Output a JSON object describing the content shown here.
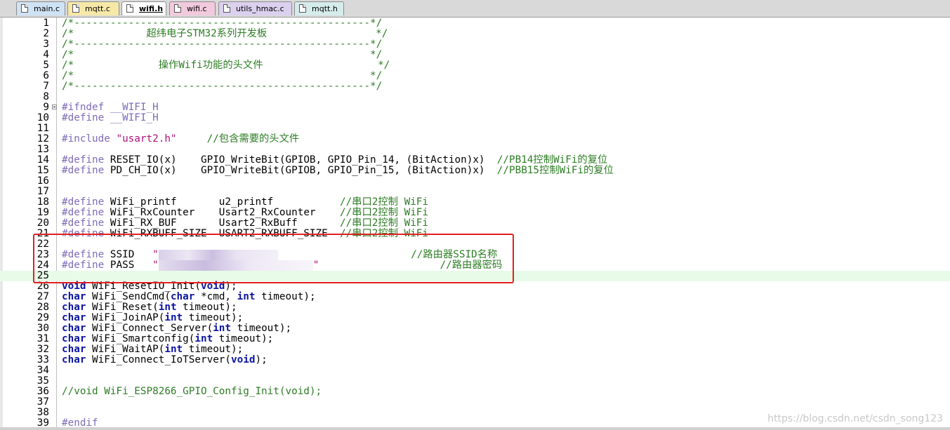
{
  "tabs": [
    {
      "label": "main.c",
      "color": "#cfe3f5",
      "active": false
    },
    {
      "label": "mqtt.c",
      "color": "#f6e9a8",
      "active": false
    },
    {
      "label": "wifi.h",
      "color": "#dff0c8",
      "active": true
    },
    {
      "label": "wifi.c",
      "color": "#f3c9dd",
      "active": false
    },
    {
      "label": "utils_hmac.c",
      "color": "#dcd0ef",
      "active": false
    },
    {
      "label": "mqtt.h",
      "color": "#d6ecec",
      "active": false
    }
  ],
  "editor": {
    "current_line": 25,
    "lines": [
      {
        "n": "1",
        "segs": [
          [
            "c",
            "/*-------------------------------------------------*/"
          ]
        ]
      },
      {
        "n": "2",
        "segs": [
          [
            "c",
            "/*            超纬电子STM32系列开发板                  */"
          ]
        ]
      },
      {
        "n": "3",
        "segs": [
          [
            "c",
            "/*-------------------------------------------------*/"
          ]
        ]
      },
      {
        "n": "4",
        "segs": [
          [
            "c",
            "/*                                                 */"
          ]
        ]
      },
      {
        "n": "5",
        "segs": [
          [
            "c",
            "/*              操作Wifi功能的头文件                   */"
          ]
        ]
      },
      {
        "n": "6",
        "segs": [
          [
            "c",
            "/*                                                 */"
          ]
        ]
      },
      {
        "n": "7",
        "segs": [
          [
            "c",
            "/*-------------------------------------------------*/"
          ]
        ]
      },
      {
        "n": "8",
        "segs": []
      },
      {
        "n": "9",
        "fold": true,
        "segs": [
          [
            "pp",
            "#ifndef __WIFI_H"
          ]
        ]
      },
      {
        "n": "10",
        "segs": [
          [
            "pp",
            "#define __WIFI_H"
          ]
        ]
      },
      {
        "n": "11",
        "segs": []
      },
      {
        "n": "12",
        "segs": [
          [
            "pp",
            "#include "
          ],
          [
            "st",
            "\"usart2.h\""
          ],
          [
            "pl",
            "     "
          ],
          [
            "c",
            "//包含需要的头文件"
          ]
        ]
      },
      {
        "n": "13",
        "segs": []
      },
      {
        "n": "14",
        "segs": [
          [
            "pp",
            "#define "
          ],
          [
            "pl",
            "RESET_IO(x)    GPIO_WriteBit(GPIOB, GPIO_Pin_14, (BitAction)x)  "
          ],
          [
            "c",
            "//PB14控制WiFi的复位"
          ]
        ]
      },
      {
        "n": "15",
        "segs": [
          [
            "pp",
            "#define "
          ],
          [
            "pl",
            "PD_CH_IO(x)    GPIO_WriteBit(GPIOB, GPIO_Pin_15, (BitAction)x)  "
          ],
          [
            "c",
            "//PBB15控制WiFi的复位"
          ]
        ]
      },
      {
        "n": "16",
        "segs": []
      },
      {
        "n": "17",
        "segs": []
      },
      {
        "n": "18",
        "segs": [
          [
            "pp",
            "#define "
          ],
          [
            "pl",
            "WiFi_printf       u2_printf           "
          ],
          [
            "c",
            "//串口2控制 WiFi"
          ]
        ]
      },
      {
        "n": "19",
        "segs": [
          [
            "pp",
            "#define "
          ],
          [
            "pl",
            "WiFi_RxCounter    Usart2_RxCounter    "
          ],
          [
            "c",
            "//串口2控制 WiFi"
          ]
        ]
      },
      {
        "n": "20",
        "segs": [
          [
            "pp",
            "#define "
          ],
          [
            "pl",
            "WiFi_RX_BUF       Usart2_RxBuff       "
          ],
          [
            "c",
            "//串口2控制 WiFi"
          ]
        ]
      },
      {
        "n": "21",
        "segs": [
          [
            "pp",
            "#define "
          ],
          [
            "pl",
            "WiFi_RXBUFF_SIZE  USART2_RXBUFF_SIZE  "
          ],
          [
            "c",
            "//串口2控制 WiFi"
          ]
        ]
      },
      {
        "n": "22",
        "segs": []
      },
      {
        "n": "23",
        "segs": [
          [
            "pp",
            "#define "
          ],
          [
            "pl",
            "SSID   "
          ],
          [
            "st",
            "\""
          ],
          [
            "blur",
            ""
          ],
          [
            "pl",
            "                      "
          ],
          [
            "c",
            "//路由器SSID名称"
          ]
        ]
      },
      {
        "n": "24",
        "segs": [
          [
            "pp",
            "#define "
          ],
          [
            "pl",
            "PASS   "
          ],
          [
            "st",
            "\""
          ],
          [
            "blur2",
            ""
          ],
          [
            "st",
            "\""
          ],
          [
            "pl",
            "                    "
          ],
          [
            "c",
            "//路由器密码"
          ]
        ]
      },
      {
        "n": "25",
        "segs": []
      },
      {
        "n": "26",
        "segs": [
          [
            "kw",
            "void"
          ],
          [
            "pl",
            " WiFi_ResetIO_Init("
          ],
          [
            "kw",
            "void"
          ],
          [
            "pl",
            ");"
          ]
        ]
      },
      {
        "n": "27",
        "segs": [
          [
            "kw",
            "char"
          ],
          [
            "pl",
            " WiFi_SendCmd("
          ],
          [
            "kw",
            "char"
          ],
          [
            "pl",
            " *cmd, "
          ],
          [
            "kw",
            "int"
          ],
          [
            "pl",
            " timeout);"
          ]
        ]
      },
      {
        "n": "28",
        "segs": [
          [
            "kw",
            "char"
          ],
          [
            "pl",
            " WiFi_Reset("
          ],
          [
            "kw",
            "int"
          ],
          [
            "pl",
            " timeout);"
          ]
        ]
      },
      {
        "n": "29",
        "segs": [
          [
            "kw",
            "char"
          ],
          [
            "pl",
            " WiFi_JoinAP("
          ],
          [
            "kw",
            "int"
          ],
          [
            "pl",
            " timeout);"
          ]
        ]
      },
      {
        "n": "30",
        "segs": [
          [
            "kw",
            "char"
          ],
          [
            "pl",
            " WiFi_Connect_Server("
          ],
          [
            "kw",
            "int"
          ],
          [
            "pl",
            " timeout);"
          ]
        ]
      },
      {
        "n": "31",
        "segs": [
          [
            "kw",
            "char"
          ],
          [
            "pl",
            " WiFi_Smartconfig("
          ],
          [
            "kw",
            "int"
          ],
          [
            "pl",
            " timeout);"
          ]
        ]
      },
      {
        "n": "32",
        "segs": [
          [
            "kw",
            "char"
          ],
          [
            "pl",
            " WiFi_WaitAP("
          ],
          [
            "kw",
            "int"
          ],
          [
            "pl",
            " timeout);"
          ]
        ]
      },
      {
        "n": "33",
        "segs": [
          [
            "kw",
            "char"
          ],
          [
            "pl",
            " WiFi_Connect_IoTServer("
          ],
          [
            "kw",
            "void"
          ],
          [
            "pl",
            ");"
          ]
        ]
      },
      {
        "n": "34",
        "segs": []
      },
      {
        "n": "35",
        "segs": []
      },
      {
        "n": "36",
        "segs": [
          [
            "c",
            "//void WiFi_ESP8266_GPIO_Config_Init(void);"
          ]
        ]
      },
      {
        "n": "37",
        "segs": []
      },
      {
        "n": "38",
        "segs": []
      },
      {
        "n": "39",
        "segs": [
          [
            "pp",
            "#endif"
          ]
        ]
      }
    ]
  },
  "watermark": "https://blog.csdn.net/csdn_song123",
  "highlight_color": "#e02020"
}
